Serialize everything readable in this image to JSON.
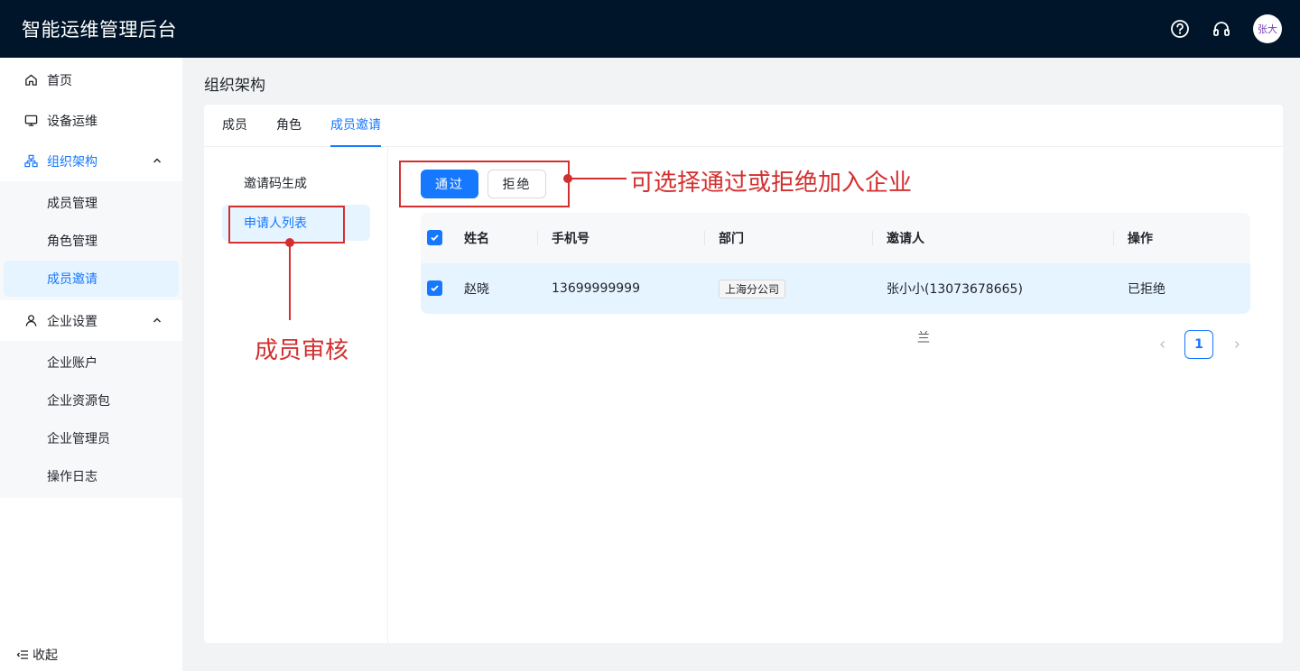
{
  "header": {
    "app_title": "智能运维管理后台",
    "avatar_text": "张大"
  },
  "sidebar": {
    "items": [
      {
        "label": "首页",
        "icon": "home-icon"
      },
      {
        "label": "设备运维",
        "icon": "monitor-icon"
      },
      {
        "label": "组织架构",
        "icon": "org-tree-icon",
        "expanded": true
      },
      {
        "label": "企业设置",
        "icon": "user-icon",
        "expanded": true
      }
    ],
    "org_children": [
      "成员管理",
      "角色管理",
      "成员邀请"
    ],
    "company_children": [
      "企业账户",
      "企业资源包",
      "企业管理员",
      "操作日志"
    ],
    "collapse_label": "收起"
  },
  "main": {
    "page_title": "组织架构",
    "tabs": [
      "成员",
      "角色",
      "成员邀请"
    ],
    "active_tab": "成员邀请",
    "left_menu": [
      "邀请码生成",
      "申请人列表"
    ],
    "buttons": {
      "approve": "通过",
      "reject": "拒绝"
    },
    "table": {
      "columns": [
        "姓名",
        "手机号",
        "部门",
        "邀请人",
        "操作"
      ],
      "rows": [
        {
          "name": "赵晓",
          "phone": "13699999999",
          "department": "上海分公司",
          "inviter": "张小小(13073678665)",
          "action": "已拒绝",
          "checked": true
        }
      ]
    },
    "misc_glyph": "兰",
    "pagination": {
      "current": "1"
    }
  },
  "annotations": {
    "buttons_note": "可选择通过或拒绝加入企业",
    "list_note": "成员审核"
  },
  "colors": {
    "primary": "#1677ff",
    "header_bg": "#001529",
    "annotation": "#d32f2f"
  }
}
